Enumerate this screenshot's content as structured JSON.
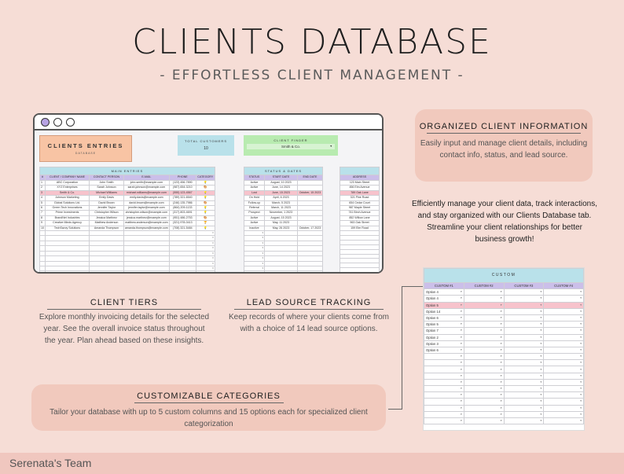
{
  "title": "CLIENTS DATABASE",
  "subtitle": "- EFFORTLESS CLIENT MANAGEMENT -",
  "window": {
    "clients_entries": {
      "title": "CLIENTS ENTRIES",
      "sub": "DATABASE"
    },
    "total_customers": {
      "label": "TOTAL CUSTOMERS",
      "value": "10"
    },
    "client_finder": {
      "label": "CLIENT FINDER",
      "value": "Smith & Co."
    },
    "main_entries_label": "MAIN ENTRIES",
    "status_dates_label": "STATUS & DATES",
    "main_headers": [
      "#",
      "CLIENT / COMPANY NAME",
      "CONTACT PERSON",
      "E-MAIL",
      "PHONE",
      "CATEGORY"
    ],
    "status_headers": [
      "STATUS",
      "START DATE",
      "END DATE"
    ],
    "address_header": "ADDRESS",
    "rows": [
      {
        "n": "1",
        "company": "ABC Corporation",
        "contact": "John Smith",
        "email": "john.smith@example.com",
        "phone": "(123) 456-7890",
        "cat": "💡",
        "status": "Active",
        "start": "August, 10 2023",
        "end": "",
        "address": "123 Main Street"
      },
      {
        "n": "2",
        "company": "XYZ Enterprises",
        "contact": "Sarah Johnson",
        "email": "sarah.johnson@example.com",
        "phone": "(987) 654-3210",
        "cat": "🎨",
        "status": "Active",
        "start": "June, 14 2023",
        "end": "",
        "address": "456 Elm Avenue"
      },
      {
        "n": "3",
        "company": "Smith & Co.",
        "contact": "Michael Williams",
        "email": "michael.williams@example.com",
        "phone": "(555) 123-4567",
        "cat": "💡",
        "status": "Lost",
        "start": "June, 15 2023",
        "end": "October, 15 2023",
        "address": "789 Oak Lane"
      },
      {
        "n": "4",
        "company": "Johnson Marketing",
        "contact": "Emily Davis",
        "email": "emily.davis@example.com",
        "phone": "(789) 321-6540",
        "cat": "💡",
        "status": "On Hold",
        "start": "April, 6 2023",
        "end": "",
        "address": "321 Pine Road"
      },
      {
        "n": "5",
        "company": "Global Solutions Ltd.",
        "contact": "David Brown",
        "email": "david.brown@example.com",
        "phone": "(246) 135-7986",
        "cat": "🎨",
        "status": "Follow-up",
        "start": "March, 5 2023",
        "end": "",
        "address": "654 Cedar Court"
      },
      {
        "n": "6",
        "company": "Green Tech Innovations",
        "contact": "Jennifer Taylor",
        "email": "jennifer.taylor@example.com",
        "phone": "(864) 209-1133",
        "cat": "💡",
        "status": "Referral",
        "start": "March, 11 2023",
        "end": "",
        "address": "987 Maple Street"
      },
      {
        "n": "7",
        "company": "Prime Investments",
        "contact": "Christopher Wilson",
        "email": "christopher.wilson@example.com",
        "phone": "(317) 803-4691",
        "cat": "💡",
        "status": "Prospect",
        "start": "November, 1 2023",
        "end": "",
        "address": "741 Birch Avenue"
      },
      {
        "n": "8",
        "company": "BrandNet Industries",
        "contact": "Jessica Martinez",
        "email": "jessica.martinez@example.com",
        "phone": "(951) 486-2753",
        "cat": "🎨",
        "status": "Active",
        "start": "August, 15 2023",
        "end": "",
        "address": "852 Willow Lane"
      },
      {
        "n": "9",
        "company": "Creative Minds Agency",
        "contact": "Matthew Anderson",
        "email": "matthew.anderson@example.com",
        "phone": "(321) 978-0413",
        "cat": "🏆",
        "status": "Active",
        "start": "May, 11 2023",
        "end": "",
        "address": "963 Oak Street"
      },
      {
        "n": "10",
        "company": "TechSavvy Solutions",
        "contact": "Amanda Thompson",
        "email": "amanda.thompson@example.com",
        "phone": "(708) 321-5484",
        "cat": "💡",
        "status": "Inactive",
        "start": "May, 26 2023",
        "end": "October, 17 2023",
        "address": "159 Elm Road"
      }
    ]
  },
  "organized": {
    "title": "ORGANIZED CLIENT INFORMATION",
    "body": "Easily input and manage client details, including contact info, status, and lead source."
  },
  "efficient_text": "Efficiently manage your client data, track interactions, and stay organized with our Clients Database tab. Streamline your client relationships for better business growth!",
  "client_tiers": {
    "title": "CLIENT TIERS",
    "body": "Explore monthly invoicing details for the selected year. See the overall invoice status throughout the year. Plan ahead based on these insights."
  },
  "lead_source": {
    "title": "LEAD SOURCE TRACKING",
    "body": "Keep records of where your clients come from with a choice of 14 lead source options."
  },
  "custom_categories": {
    "title": "CUSTOMIZABLE CATEGORIES",
    "body": "Tailor your database with up to 5 custom columns and 15 options each for specialized client categorization"
  },
  "custom_panel": {
    "label": "CUSTOM",
    "headers": [
      "CUSTOM #1",
      "CUSTOM #2",
      "CUSTOM #3",
      "CUSTOM #4"
    ],
    "options": [
      "Option 4",
      "Option 4",
      "Option 5",
      "Option 14",
      "Option 6",
      "Option 5",
      "Option 7",
      "Option 2",
      "Option 3",
      "Option 6"
    ]
  },
  "footer": "Serenata's Team"
}
